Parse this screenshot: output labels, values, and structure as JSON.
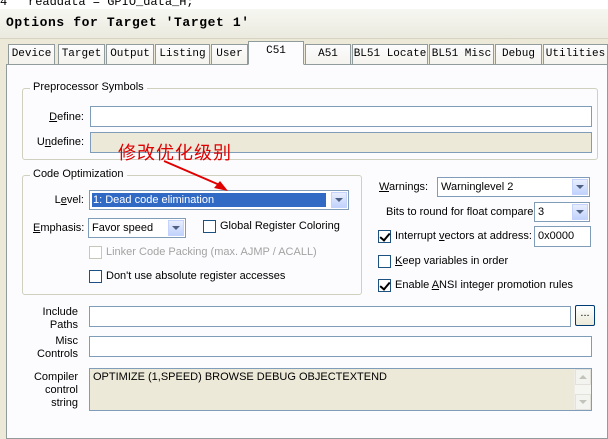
{
  "background_code": {
    "line_number": "4",
    "text": "readdata = GPIO_data_H;"
  },
  "window": {
    "title": "Options for Target 'Target 1'"
  },
  "tabs": [
    {
      "label": "Device",
      "active": false
    },
    {
      "label": "Target",
      "active": false
    },
    {
      "label": "Output",
      "active": false
    },
    {
      "label": "Listing",
      "active": false
    },
    {
      "label": "User",
      "active": false
    },
    {
      "label": "C51",
      "active": true
    },
    {
      "label": "A51",
      "active": false
    },
    {
      "label": "BL51 Locate",
      "active": false
    },
    {
      "label": "BL51 Misc",
      "active": false
    },
    {
      "label": "Debug",
      "active": false
    },
    {
      "label": "Utilities",
      "active": false
    }
  ],
  "preprocessor": {
    "group_title": "Preprocessor Symbols",
    "define_label": "Define:",
    "define_value": "",
    "undefine_label": "Undefine:",
    "undefine_value": ""
  },
  "code_optimization": {
    "group_title": "Code Optimization",
    "level_label": "Level:",
    "level_value": "1: Dead code elimination",
    "emphasis_label": "Emphasis:",
    "emphasis_value": "Favor speed",
    "global_register_coloring": {
      "label": "Global Register Coloring",
      "checked": false
    },
    "linker_code_packing": {
      "label": "Linker Code Packing (max. AJMP / ACALL)",
      "checked": false,
      "disabled": true
    },
    "dont_use_absolute": {
      "label": "Don't use absolute register accesses",
      "checked": false
    }
  },
  "annotation": {
    "text": "修改优化级别",
    "color": "#e00000"
  },
  "right_options": {
    "warnings_label": "Warnings:",
    "warnings_value": "Warninglevel 2",
    "bits_label": "Bits to round for float compare:",
    "bits_value": "3",
    "interrupt_vectors": {
      "label": "Interrupt vectors at address:",
      "checked": true,
      "address": "0x0000"
    },
    "keep_variables": {
      "label": "Keep variables in order",
      "checked": false
    },
    "enable_ansi": {
      "label": "Enable ANSI integer promotion rules",
      "checked": true
    }
  },
  "include_paths": {
    "label_line1": "Include",
    "label_line2": "Paths",
    "value": "",
    "browse_label": "..."
  },
  "misc_controls": {
    "label_line1": "Misc",
    "label_line2": "Controls",
    "value": ""
  },
  "compiler_control": {
    "label_line1": "Compiler",
    "label_line2": "control",
    "label_line3": "string",
    "value": "OPTIMIZE (1,SPEED) BROWSE DEBUG OBJECTEXTEND"
  },
  "colors": {
    "selection": "#316ac5",
    "check_green": "#21a121",
    "dialog_bg": "#ece9d8",
    "panel_bg": "#fcfcfe"
  }
}
